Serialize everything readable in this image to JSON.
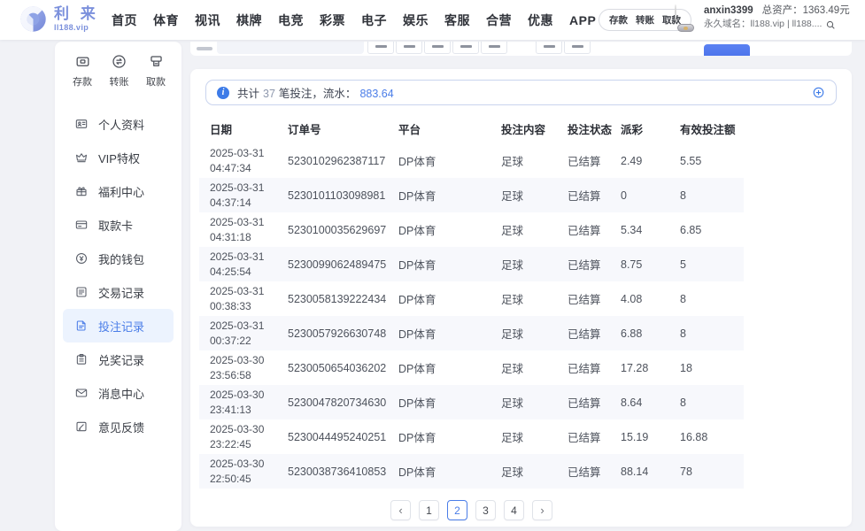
{
  "colors": {
    "accent": "#4a7de8",
    "logo_blue": "#7b90dc",
    "info_blue": "#3d7be8",
    "active_bg": "#ecf3fe",
    "stripe": "#f7f8fc",
    "summary_border": "#c9d4ee"
  },
  "header": {
    "logo_title": "利 来",
    "logo_domain": "ll188.vip",
    "nav": [
      {
        "name": "home",
        "label": "首页"
      },
      {
        "name": "sports",
        "label": "体育"
      },
      {
        "name": "live-video",
        "label": "视讯"
      },
      {
        "name": "board-games",
        "label": "棋牌"
      },
      {
        "name": "esports",
        "label": "电竞"
      },
      {
        "name": "lottery",
        "label": "彩票"
      },
      {
        "name": "slots",
        "label": "电子"
      },
      {
        "name": "entertainment",
        "label": "娱乐"
      },
      {
        "name": "support",
        "label": "客服"
      },
      {
        "name": "partnership",
        "label": "合营"
      },
      {
        "name": "promotions",
        "label": "优惠"
      },
      {
        "name": "app",
        "label": "APP"
      }
    ],
    "wallet_pill": [
      {
        "name": "deposit",
        "label": "存款"
      },
      {
        "name": "transfer",
        "label": "转账"
      },
      {
        "name": "withdraw",
        "label": "取款"
      }
    ],
    "user": {
      "name": "anxin3399",
      "assets_label": "总资产：",
      "assets_value": "1363.49元",
      "domain_line": "永久域名：ll188.vip | ll188...."
    }
  },
  "sidebar": {
    "quick_actions": [
      {
        "name": "deposit",
        "icon": "deposit",
        "label": "存款"
      },
      {
        "name": "transfer",
        "icon": "transfer",
        "label": "转账"
      },
      {
        "name": "withdraw",
        "icon": "withdraw",
        "label": "取款"
      }
    ],
    "items": [
      {
        "name": "profile",
        "icon": "profile",
        "label": "个人资料",
        "active": false
      },
      {
        "name": "vip",
        "icon": "vip",
        "label": "VIP特权",
        "active": false
      },
      {
        "name": "welfare-center",
        "icon": "welfare",
        "label": "福利中心",
        "active": false
      },
      {
        "name": "withdraw-card",
        "icon": "card",
        "label": "取款卡",
        "active": false
      },
      {
        "name": "my-wallet",
        "icon": "wallet",
        "label": "我的钱包",
        "active": false
      },
      {
        "name": "transaction-records",
        "icon": "transactions",
        "label": "交易记录",
        "active": false
      },
      {
        "name": "bet-records",
        "icon": "bets",
        "label": "投注记录",
        "active": true
      },
      {
        "name": "redeem-records",
        "icon": "redeem",
        "label": "兑奖记录",
        "active": false
      },
      {
        "name": "message-center",
        "icon": "messages",
        "label": "消息中心",
        "active": false
      },
      {
        "name": "feedback",
        "icon": "feedback",
        "label": "意见反馈",
        "active": false
      }
    ]
  },
  "records": {
    "summary": {
      "pre": "共计",
      "count": "37",
      "mid": "笔投注，流水：",
      "amount": "883.64"
    },
    "table": {
      "headers": [
        "日期",
        "订单号",
        "平台",
        "投注内容",
        "投注状态",
        "派彩",
        "有效投注额"
      ],
      "rows": [
        {
          "date": "2025-03-31",
          "time": "04:47:34",
          "order": "5230102962387117",
          "platform": "DP体育",
          "content": "足球",
          "status": "已结算",
          "payout": "2.49",
          "valid": "5.55"
        },
        {
          "date": "2025-03-31",
          "time": "04:37:14",
          "order": "5230101103098981",
          "platform": "DP体育",
          "content": "足球",
          "status": "已结算",
          "payout": "0",
          "valid": "8"
        },
        {
          "date": "2025-03-31",
          "time": "04:31:18",
          "order": "5230100035629697",
          "platform": "DP体育",
          "content": "足球",
          "status": "已结算",
          "payout": "5.34",
          "valid": "6.85"
        },
        {
          "date": "2025-03-31",
          "time": "04:25:54",
          "order": "5230099062489475",
          "platform": "DP体育",
          "content": "足球",
          "status": "已结算",
          "payout": "8.75",
          "valid": "5"
        },
        {
          "date": "2025-03-31",
          "time": "00:38:33",
          "order": "5230058139222434",
          "platform": "DP体育",
          "content": "足球",
          "status": "已结算",
          "payout": "4.08",
          "valid": "8"
        },
        {
          "date": "2025-03-31",
          "time": "00:37:22",
          "order": "5230057926630748",
          "platform": "DP体育",
          "content": "足球",
          "status": "已结算",
          "payout": "6.88",
          "valid": "8"
        },
        {
          "date": "2025-03-30",
          "time": "23:56:58",
          "order": "5230050654036202",
          "platform": "DP体育",
          "content": "足球",
          "status": "已结算",
          "payout": "17.28",
          "valid": "18"
        },
        {
          "date": "2025-03-30",
          "time": "23:41:13",
          "order": "5230047820734630",
          "platform": "DP体育",
          "content": "足球",
          "status": "已结算",
          "payout": "8.64",
          "valid": "8"
        },
        {
          "date": "2025-03-30",
          "time": "23:22:45",
          "order": "5230044495240251",
          "platform": "DP体育",
          "content": "足球",
          "status": "已结算",
          "payout": "15.19",
          "valid": "16.88"
        },
        {
          "date": "2025-03-30",
          "time": "22:50:45",
          "order": "5230038736410853",
          "platform": "DP体育",
          "content": "足球",
          "status": "已结算",
          "payout": "88.14",
          "valid": "78"
        }
      ]
    },
    "pagination": {
      "prev": "‹",
      "pages": [
        "1",
        "2",
        "3",
        "4"
      ],
      "active": "2",
      "next": "›"
    }
  }
}
